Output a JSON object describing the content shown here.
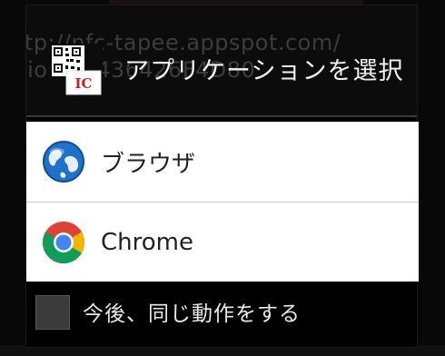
{
  "dialog": {
    "title": "アプリケーションを選択",
    "background_text": "ttp://nfc-tapee.appspot.com/\nzio=0C436426F4D80"
  },
  "apps": [
    {
      "label": "ブラウザ",
      "icon": "globe-icon"
    },
    {
      "label": "Chrome",
      "icon": "chrome-icon"
    }
  ],
  "footer": {
    "checkbox_label": "今後、同じ動作をする",
    "checked": false
  },
  "app_icon": {
    "badge_text": "IC",
    "icon": "qr-code-icon"
  }
}
